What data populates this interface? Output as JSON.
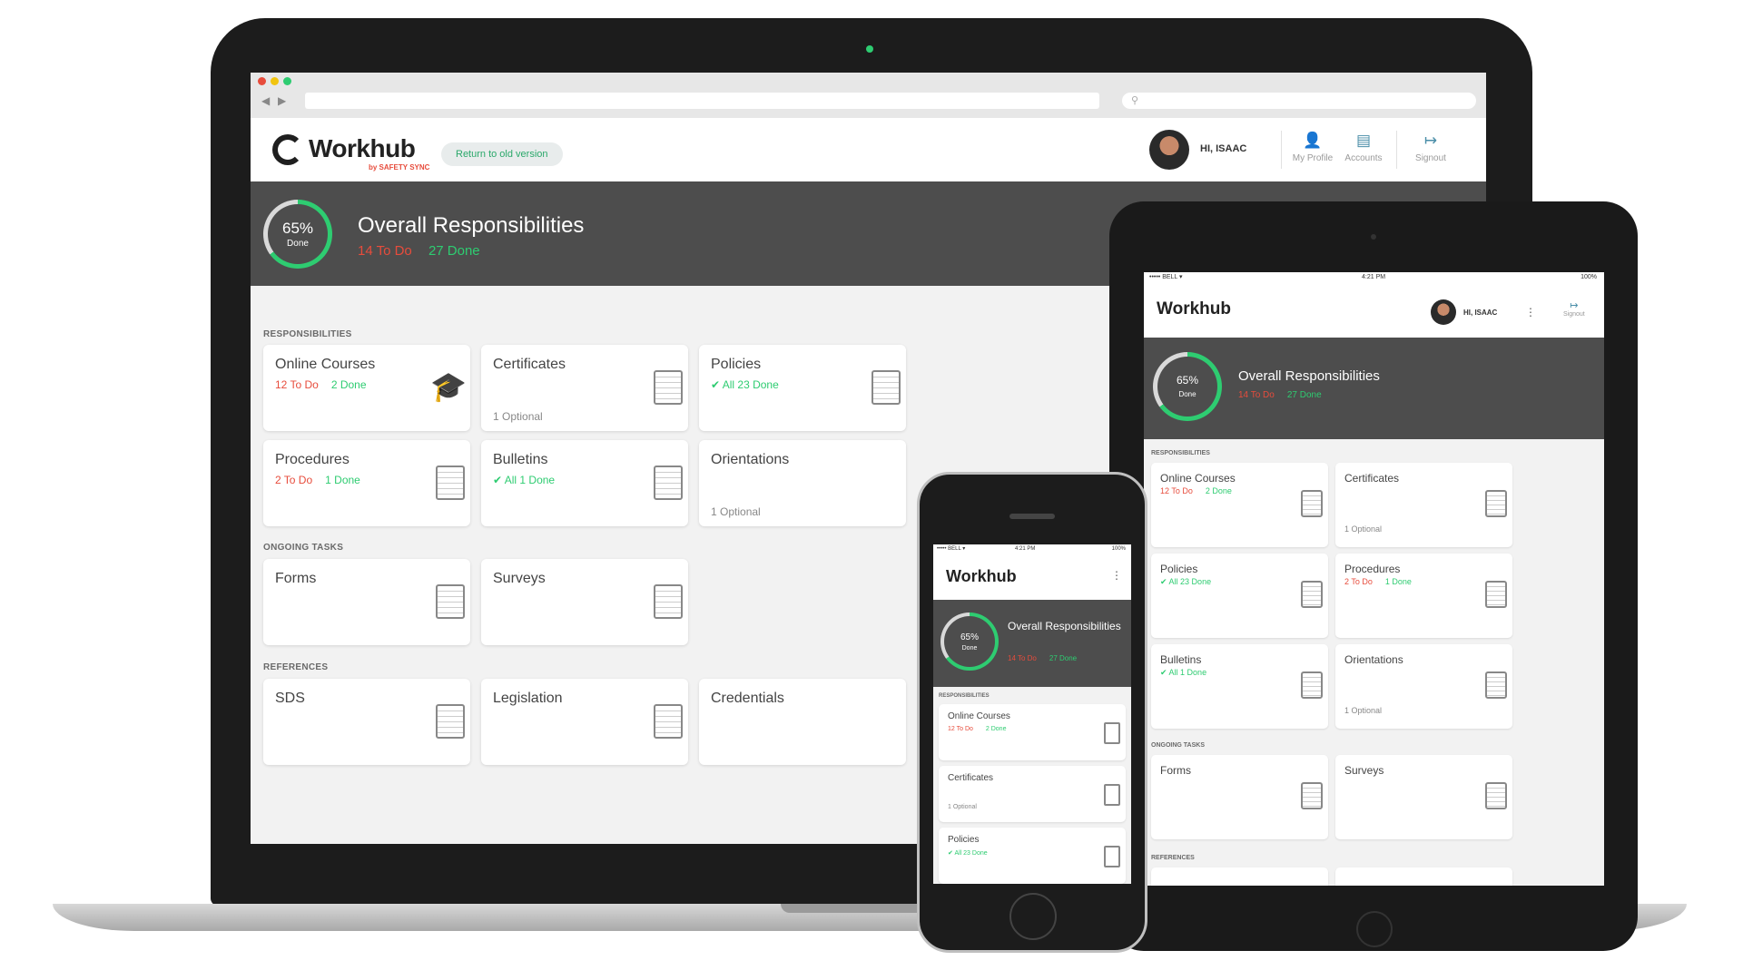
{
  "colors": {
    "accent_green": "#2ecc71",
    "todo_red": "#e74c3c",
    "banner_gray": "#4d4d4d",
    "icon_blue": "#4a8ea8"
  },
  "desktop": {
    "brand": {
      "name": "Workhub",
      "sub": "by SAFETY SYNC"
    },
    "old_version_label": "Return to old version",
    "search_icon": "search-icon",
    "user": {
      "greeting": "HI, ISAAC"
    },
    "nav": [
      {
        "label": "My Profile",
        "icon": "user-icon"
      },
      {
        "label": "Accounts",
        "icon": "accounts-icon"
      },
      {
        "label": "Signout",
        "icon": "signout-icon"
      }
    ],
    "overall": {
      "percent": "65%",
      "percent_value": 65,
      "done_label": "Done",
      "title": "Overall Responsibilities",
      "todo": "14 To Do",
      "done": "27 Done"
    },
    "sections": {
      "responsibilities": "RESPONSIBILITIES",
      "ongoing": "ONGOING TASKS",
      "references": "REFERENCES"
    },
    "cards": {
      "online_courses": {
        "title": "Online Courses",
        "todo": "12 To Do",
        "done": "2 Done"
      },
      "certificates": {
        "title": "Certificates",
        "optional": "1 Optional"
      },
      "policies": {
        "title": "Policies",
        "done": "All 23 Done"
      },
      "procedures": {
        "title": "Procedures",
        "todo": "2 To Do",
        "done": "1 Done"
      },
      "bulletins": {
        "title": "Bulletins",
        "done": "All 1 Done"
      },
      "orientations": {
        "title": "Orientations",
        "optional": "1 Optional"
      },
      "forms": {
        "title": "Forms"
      },
      "surveys": {
        "title": "Surveys"
      },
      "sds": {
        "title": "SDS"
      },
      "legislation": {
        "title": "Legislation"
      },
      "credentials": {
        "title": "Credentials"
      }
    }
  },
  "tablet": {
    "status": {
      "carrier": "••••• BELL ▾",
      "time": "4:21 PM",
      "battery": "100%"
    },
    "brand": "Workhub",
    "greeting": "HI, ISAAC",
    "menu_glyph": "⋮",
    "signout": "Signout",
    "overall": {
      "percent": "65%",
      "done_label": "Done",
      "title": "Overall Responsibilities",
      "todo": "14 To Do",
      "done": "27 Done"
    },
    "sections": {
      "responsibilities": "RESPONSIBILITIES",
      "ongoing": "ONGOING TASKS",
      "references": "REFERENCES"
    },
    "cards": {
      "online_courses": {
        "title": "Online Courses",
        "todo": "12 To Do",
        "done": "2 Done"
      },
      "certificates": {
        "title": "Certificates",
        "optional": "1 Optional"
      },
      "policies": {
        "title": "Policies",
        "done": "All 23 Done"
      },
      "procedures": {
        "title": "Procedures",
        "todo": "2 To Do",
        "done": "1 Done"
      },
      "bulletins": {
        "title": "Bulletins",
        "done": "All 1 Done"
      },
      "orientations": {
        "title": "Orientations",
        "optional": "1 Optional"
      },
      "forms": {
        "title": "Forms"
      },
      "surveys": {
        "title": "Surveys"
      }
    }
  },
  "phone": {
    "status": {
      "carrier": "••••• BELL ▾",
      "time": "4:21 PM",
      "battery": "100%"
    },
    "brand": "Workhub",
    "menu_glyph": "⋮",
    "overall": {
      "percent": "65%",
      "done_label": "Done",
      "title": "Overall Responsibilities",
      "todo": "14 To Do",
      "done": "27 Done"
    },
    "sections": {
      "responsibilities": "RESPONSIBILITIES"
    },
    "cards": {
      "online_courses": {
        "title": "Online Courses",
        "todo": "12 To Do",
        "done": "2 Done"
      },
      "certificates": {
        "title": "Certificates",
        "optional": "1 Optional"
      },
      "policies": {
        "title": "Policies",
        "done": "All 23 Done"
      }
    }
  }
}
